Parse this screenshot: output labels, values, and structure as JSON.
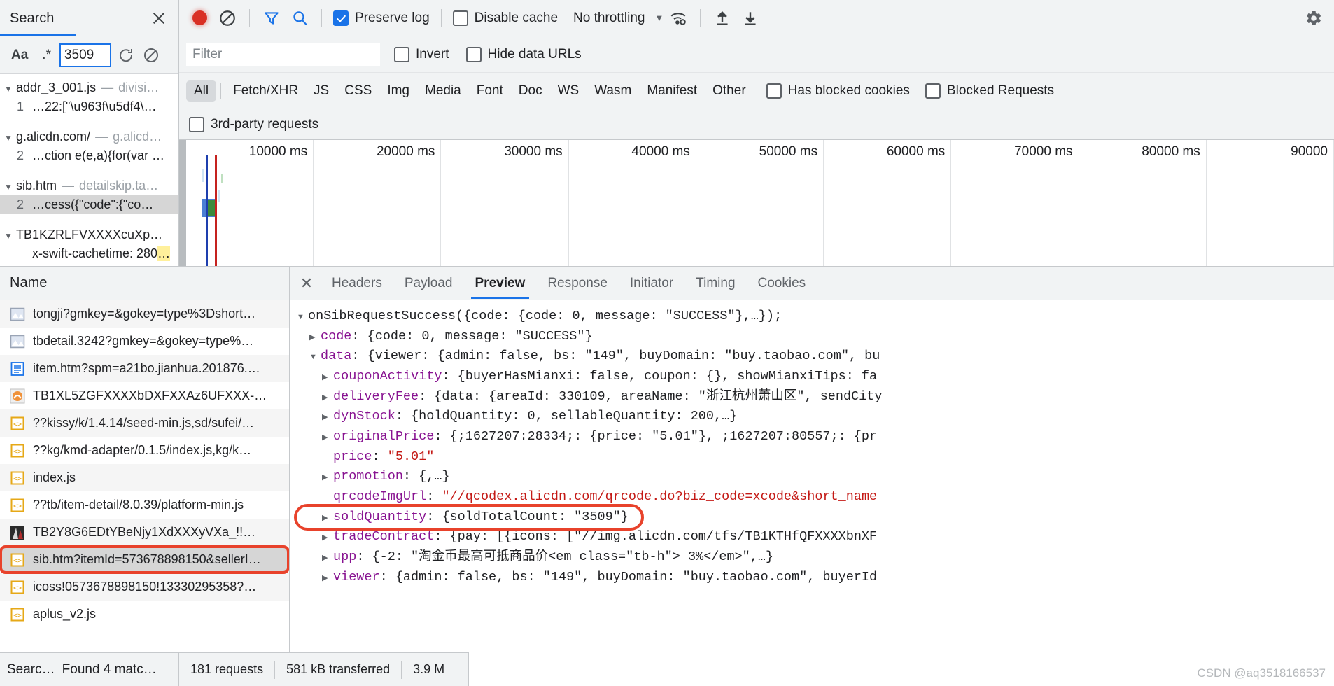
{
  "search_panel": {
    "tab_title": "Search",
    "close_icon": "close-icon",
    "controls": {
      "match_case_label": "Aa",
      "regex_label": ".*",
      "query_value": "3509",
      "refresh_icon": "refresh-icon",
      "clear_icon": "clear-icon"
    },
    "results": [
      {
        "file": "addr_3_001.js",
        "dash": "—",
        "url": "divisi…",
        "line_no": "1",
        "snippet": "…22:[\"\\u963f\\u5df4\\…",
        "selected": false
      },
      {
        "file": "g.alicdn.com/",
        "dash": "—",
        "url": "g.alicd…",
        "line_no": "2",
        "snippet": "…ction e(e,a){for(var …",
        "selected": false
      },
      {
        "file": "sib.htm",
        "dash": "—",
        "url": "detailskip.ta…",
        "line_no": "2",
        "snippet": "…cess({\"code\":{\"co…",
        "selected": true
      },
      {
        "file": "TB1KZRLFVXXXXcuXp…",
        "dash": "",
        "url": "",
        "line_no": "",
        "snippet": "x-swift-cachetime:  280",
        "snippet_suffix": "…",
        "selected": false
      }
    ],
    "footer_left": "Searc…",
    "footer_right": "Found 4 matc…"
  },
  "network_toolbar": {
    "record_icon": "record-icon",
    "clear_icon": "clear-icon",
    "filter_icon": "filter-icon",
    "search_icon": "search-icon",
    "preserve_log": {
      "label": "Preserve log",
      "checked": true
    },
    "disable_cache": {
      "label": "Disable cache",
      "checked": false
    },
    "throttling": {
      "value": "No throttling",
      "caret": "chevron-down-icon"
    },
    "wifi_icon": "network-conditions-icon",
    "import_icon": "import-har-icon",
    "export_icon": "export-har-icon",
    "settings_icon": "gear-icon"
  },
  "filter_bar": {
    "filter_placeholder": "Filter",
    "filter_value": "",
    "invert": {
      "label": "Invert",
      "checked": false
    },
    "hide_data_urls": {
      "label": "Hide data URLs",
      "checked": false
    }
  },
  "type_filters": {
    "chips": [
      "All",
      "Fetch/XHR",
      "JS",
      "CSS",
      "Img",
      "Media",
      "Font",
      "Doc",
      "WS",
      "Wasm",
      "Manifest",
      "Other"
    ],
    "active": "All",
    "has_blocked_cookies": {
      "label": "Has blocked cookies",
      "checked": false
    },
    "blocked_requests": {
      "label": "Blocked Requests",
      "checked": false
    },
    "third_party_requests": {
      "label": "3rd-party requests",
      "checked": false
    }
  },
  "overview_timeline": {
    "ticks": [
      "10000 ms",
      "20000 ms",
      "30000 ms",
      "40000 ms",
      "50000 ms",
      "60000 ms",
      "70000 ms",
      "80000 ms",
      "90000"
    ],
    "marker_blue": "DOMContentLoaded",
    "marker_red": "Load"
  },
  "request_list": {
    "column_header": "Name",
    "rows": [
      {
        "name": "tongji?gmkey=&gokey=type%3Dshort…",
        "icon": "image-icon",
        "state": ""
      },
      {
        "name": "tbdetail.3242?gmkey=&gokey=type%…",
        "icon": "image-icon",
        "state": ""
      },
      {
        "name": "item.htm?spm=a21bo.jianhua.201876.…",
        "icon": "doc-icon",
        "state": ""
      },
      {
        "name": "TB1XL5ZGFXXXXbDXFXXAz6UFXXX-…",
        "icon": "img-thumb-icon",
        "state": ""
      },
      {
        "name": "??kissy/k/1.4.14/seed-min.js,sd/sufei/…",
        "icon": "script-icon",
        "state": ""
      },
      {
        "name": "??kg/kmd-adapter/0.1.5/index.js,kg/k…",
        "icon": "script-icon",
        "state": ""
      },
      {
        "name": "index.js",
        "icon": "script-icon",
        "state": ""
      },
      {
        "name": "??tb/item-detail/8.0.39/platform-min.js",
        "icon": "script-icon",
        "state": ""
      },
      {
        "name": "TB2Y8G6EDtYBeNjy1XdXXXyVXa_!!…",
        "icon": "img-thumb-icon",
        "state": ""
      },
      {
        "name": "sib.htm?itemId=573678898150&sellerI…",
        "icon": "script-icon",
        "state": "selected-highlighted"
      },
      {
        "name": "icoss!0573678898150!13330295358?…",
        "icon": "script-icon",
        "state": ""
      },
      {
        "name": "aplus_v2.js",
        "icon": "script-icon",
        "state": ""
      }
    ],
    "footer": {
      "requests": "181 requests",
      "transferred": "581 kB transferred",
      "resources": "3.9 M"
    }
  },
  "detail_panel": {
    "close_icon": "close-icon",
    "tabs": [
      "Headers",
      "Payload",
      "Preview",
      "Response",
      "Initiator",
      "Timing",
      "Cookies"
    ],
    "active_tab": "Preview",
    "json_lines": [
      {
        "indent": 0,
        "tri": "open",
        "parts": [
          {
            "t": "onSibRequestSuccess({code: {code: 0, message: \"SUCCESS\"},…});",
            "c": "jtxt"
          }
        ]
      },
      {
        "indent": 1,
        "tri": "closed",
        "parts": [
          {
            "t": "code",
            "c": "jkey"
          },
          {
            "t": ": {code: 0, message: \"SUCCESS\"}",
            "c": "jtxt"
          }
        ]
      },
      {
        "indent": 1,
        "tri": "open",
        "parts": [
          {
            "t": "data",
            "c": "jkey"
          },
          {
            "t": ": {viewer: {admin: false, bs: \"149\", buyDomain: \"buy.taobao.com\", bu",
            "c": "jtxt"
          }
        ]
      },
      {
        "indent": 2,
        "tri": "closed",
        "parts": [
          {
            "t": "couponActivity",
            "c": "jkey"
          },
          {
            "t": ": {buyerHasMianxi: false, coupon: {}, showMianxiTips: fa",
            "c": "jtxt"
          }
        ]
      },
      {
        "indent": 2,
        "tri": "closed",
        "parts": [
          {
            "t": "deliveryFee",
            "c": "jkey"
          },
          {
            "t": ": {data: {areaId: 330109, areaName: \"浙江杭州萧山区\", sendCity",
            "c": "jtxt"
          }
        ]
      },
      {
        "indent": 2,
        "tri": "closed",
        "parts": [
          {
            "t": "dynStock",
            "c": "jkey"
          },
          {
            "t": ": {holdQuantity: 0, sellableQuantity: 200,…}",
            "c": "jtxt"
          }
        ]
      },
      {
        "indent": 2,
        "tri": "closed",
        "parts": [
          {
            "t": "originalPrice",
            "c": "jkey"
          },
          {
            "t": ": {;1627207:28334;: {price: \"5.01\"}, ;1627207:80557;: {pr",
            "c": "jtxt"
          }
        ]
      },
      {
        "indent": 2,
        "tri": "none",
        "parts": [
          {
            "t": "price",
            "c": "jkey"
          },
          {
            "t": ": ",
            "c": "jtxt"
          },
          {
            "t": "\"5.01\"",
            "c": "jstr"
          }
        ]
      },
      {
        "indent": 2,
        "tri": "closed",
        "parts": [
          {
            "t": "promotion",
            "c": "jkey"
          },
          {
            "t": ": {,…}",
            "c": "jtxt"
          }
        ]
      },
      {
        "indent": 2,
        "tri": "none",
        "parts": [
          {
            "t": "qrcodeImgUrl",
            "c": "jkey"
          },
          {
            "t": ": ",
            "c": "jtxt"
          },
          {
            "t": "\"//qcodex.alicdn.com/qrcode.do?biz_code=xcode&short_name",
            "c": "jstr"
          }
        ]
      },
      {
        "indent": 2,
        "tri": "closed",
        "highlight": true,
        "parts": [
          {
            "t": "soldQuantity",
            "c": "jkey"
          },
          {
            "t": ": {soldTotalCount: \"3509\"}",
            "c": "jtxt"
          }
        ]
      },
      {
        "indent": 2,
        "tri": "closed",
        "parts": [
          {
            "t": "tradeContract",
            "c": "jkey"
          },
          {
            "t": ": {pay: [{icons: [\"//img.alicdn.com/tfs/TB1KTHfQFXXXXbnXF",
            "c": "jtxt"
          }
        ]
      },
      {
        "indent": 2,
        "tri": "closed",
        "parts": [
          {
            "t": "upp",
            "c": "jkey"
          },
          {
            "t": ": {-2: \"淘金币最高可抵商品价<em class=\"tb-h\"> 3%</em>\",…}",
            "c": "jtxt"
          }
        ]
      },
      {
        "indent": 2,
        "tri": "closed",
        "parts": [
          {
            "t": "viewer",
            "c": "jkey"
          },
          {
            "t": ": {admin: false, bs: \"149\", buyDomain: \"buy.taobao.com\", buyerId",
            "c": "jtxt"
          }
        ]
      }
    ]
  },
  "watermark": "CSDN @aq3518166537",
  "colors": {
    "accent_blue": "#1a73e8",
    "record_red": "#d93025",
    "highlight_ring": "#e8422b",
    "json_key": "#881391",
    "json_string": "#c41a16",
    "toolbar_bg": "#f1f3f4"
  }
}
